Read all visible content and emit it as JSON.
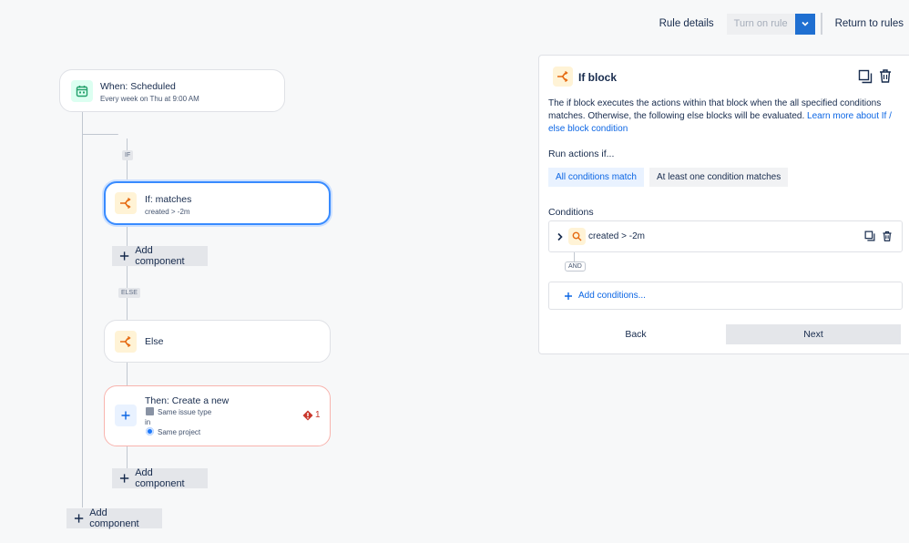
{
  "header": {
    "rule_details": "Rule details",
    "turn_on_rule": "Turn on rule",
    "return_to_rules": "Return to rules"
  },
  "flow": {
    "trigger": {
      "title": "When: Scheduled",
      "subtitle": "Every week on Thu at 9:00 AM"
    },
    "if_chip": "IF",
    "if_block": {
      "title": "If: matches",
      "subtitle": "created > -2m"
    },
    "add_component_1": "Add component",
    "else_chip": "ELSE",
    "else_block": {
      "title": "Else"
    },
    "action": {
      "title": "Then: Create a new",
      "line1": "Same issue type",
      "line2": "in",
      "line3": "Same project",
      "error_count": "1"
    },
    "add_component_2": "Add component",
    "add_component_3": "Add component"
  },
  "panel": {
    "title": "If block",
    "description": "The if block executes the actions within that block when the all specified conditions matches. Otherwise, the following else blocks will be evaluated.",
    "learn_more": "Learn more about If / else block condition",
    "run_actions_label": "Run actions if...",
    "option_all": "All conditions match",
    "option_any": "At least one condition matches",
    "conditions_label": "Conditions",
    "condition_text": "created > -2m",
    "and_chip": "AND",
    "add_conditions": "Add conditions...",
    "back": "Back",
    "next": "Next"
  },
  "colors": {
    "accent": "#0c66e4",
    "branch_icon": "#e56910",
    "branch_bg": "#fff3d6",
    "calendar": "#22a06b",
    "error": "#c9372c"
  },
  "icons": [
    "calendar-icon",
    "branch-icon",
    "plus-icon",
    "error-icon",
    "duplicate-icon",
    "trash-icon",
    "search-icon",
    "chevron-right-icon",
    "chevron-down-icon"
  ]
}
